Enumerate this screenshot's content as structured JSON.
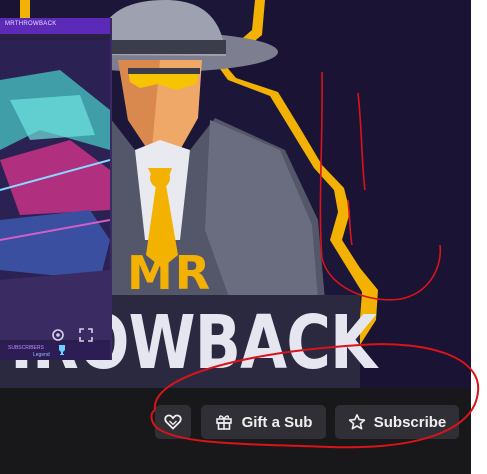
{
  "mini_player": {
    "title": "MRTHROWBACK",
    "footer_name": "SUBSCRIBERS",
    "footer_sub": "Legend"
  },
  "banner": {
    "brand_top": "MR",
    "brand_bottom": "HROWBACK"
  },
  "actions": {
    "gift_label": "Gift a Sub",
    "subscribe_label": "Subscribe"
  },
  "icons": {
    "follow": "heart-icon",
    "gift": "gift-icon",
    "subscribe": "star-icon",
    "settings": "gear-icon",
    "fullscreen": "expand-icon"
  },
  "colors": {
    "brand_yellow": "#f5b400",
    "annotation_red": "#d8141a",
    "button_bg": "#2f2f35",
    "bar_bg": "#18181b"
  }
}
